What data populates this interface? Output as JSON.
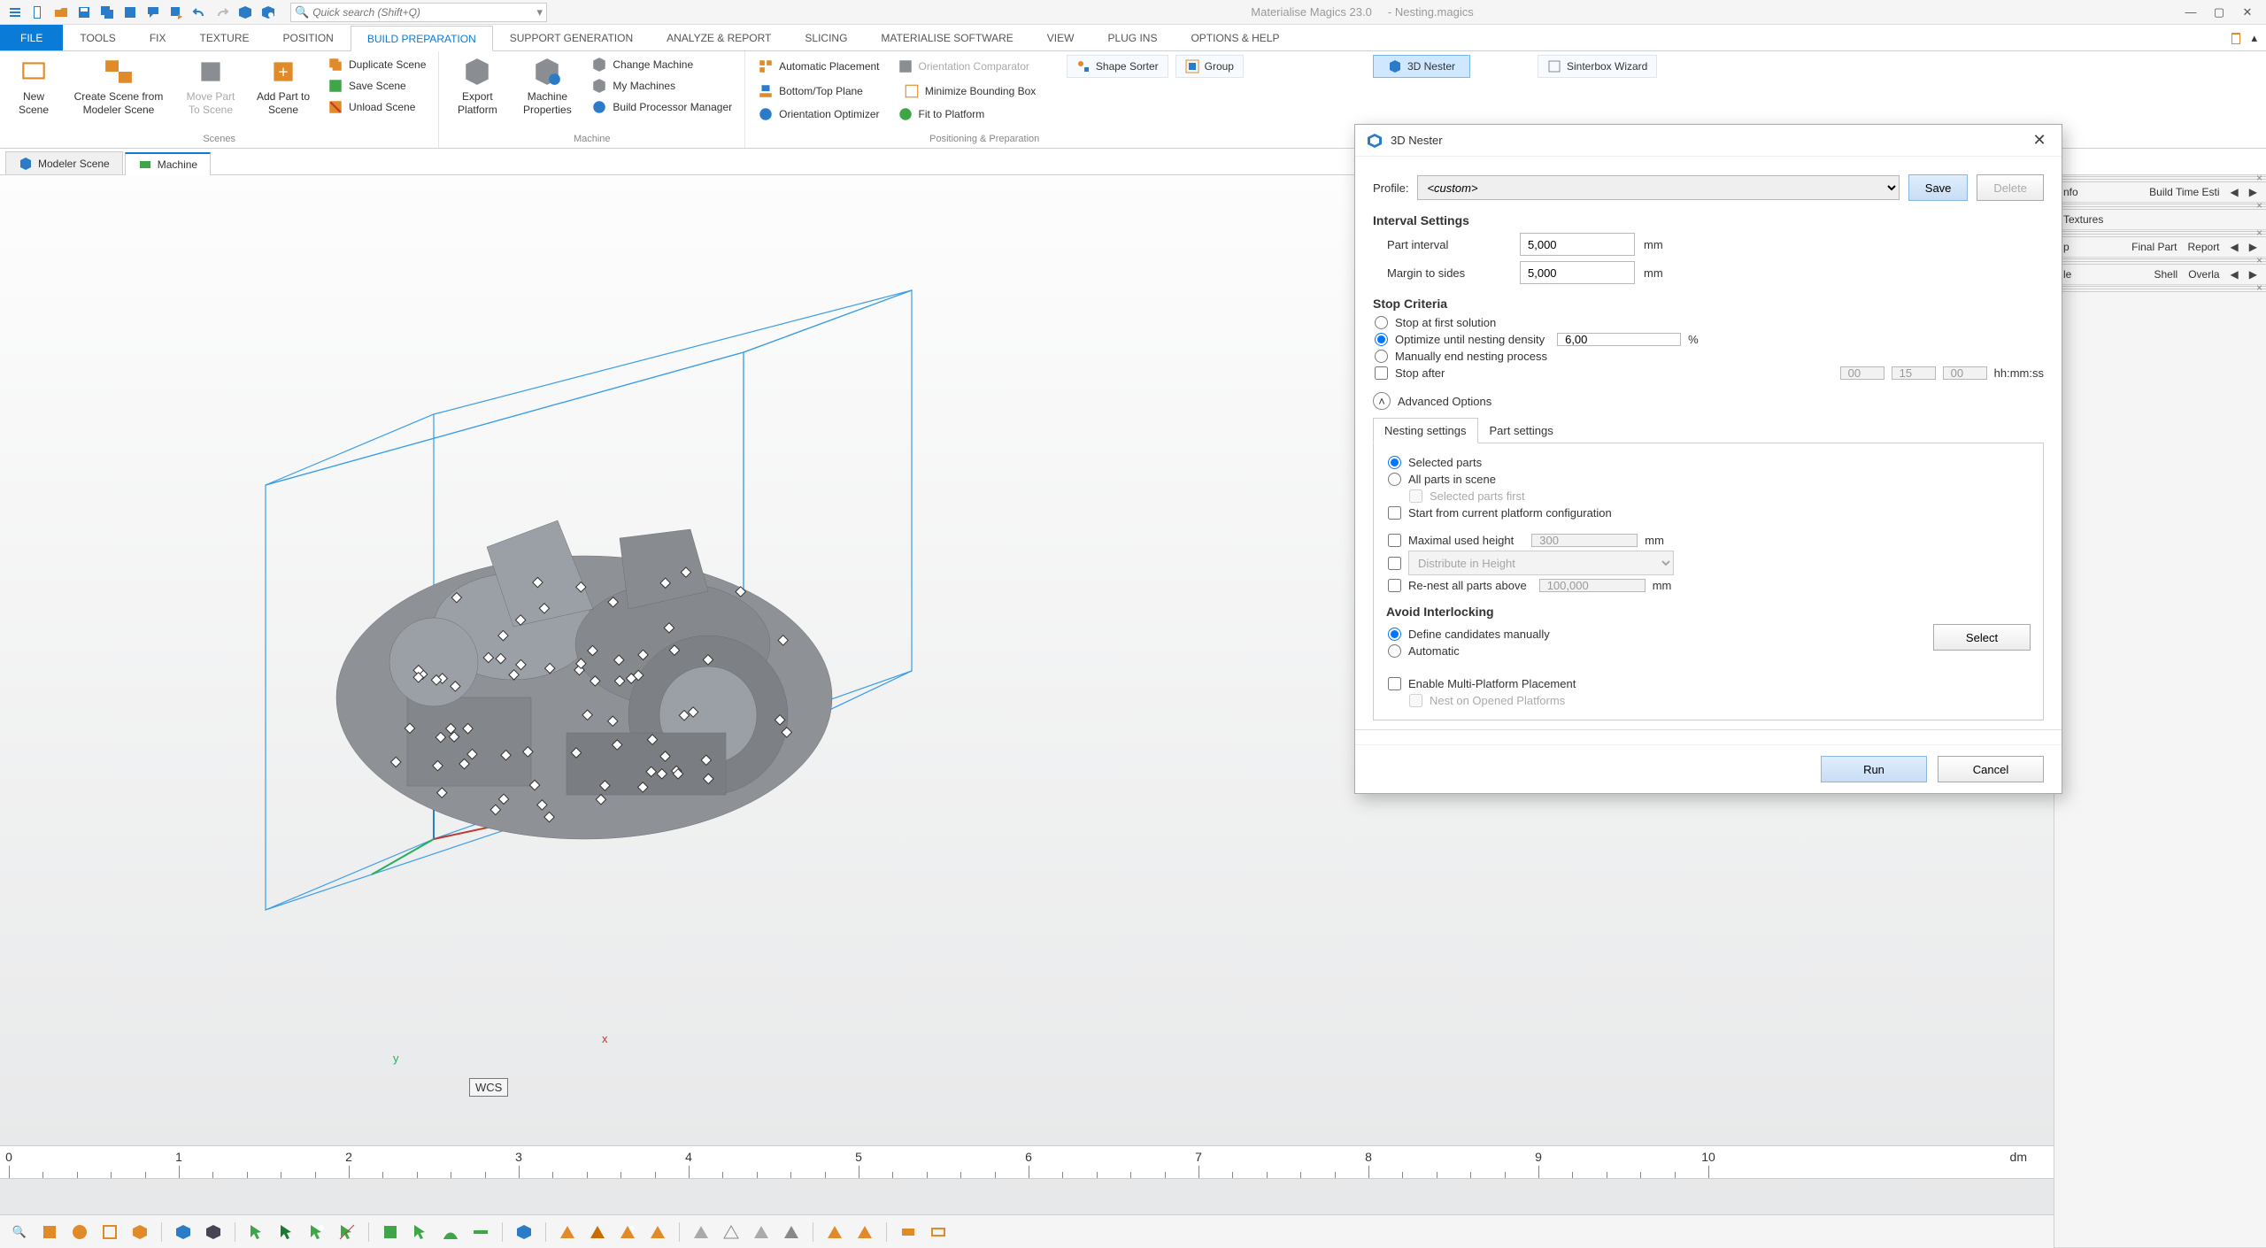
{
  "app": {
    "title_product": "Materialise Magics 23.0",
    "title_file": "- Nesting.magics",
    "search_placeholder": "Quick search (Shift+Q)"
  },
  "ribbon_tabs": {
    "file": "FILE",
    "items": [
      "TOOLS",
      "FIX",
      "TEXTURE",
      "POSITION",
      "BUILD PREPARATION",
      "SUPPORT GENERATION",
      "ANALYZE & REPORT",
      "SLICING",
      "MATERIALISE SOFTWARE",
      "VIEW",
      "PLUG INS",
      "OPTIONS & HELP"
    ],
    "active_index": 4
  },
  "ribbon": {
    "scenes": {
      "label": "Scenes",
      "new_scene": "New\nScene",
      "create_from_modeler": "Create Scene from\nModeler Scene",
      "move_to_scene": "Move Part\nTo Scene",
      "add_to_scene": "Add Part to\nScene",
      "duplicate": "Duplicate Scene",
      "save": "Save Scene",
      "unload": "Unload Scene"
    },
    "machine": {
      "label": "Machine",
      "export_platform": "Export\nPlatform",
      "machine_properties": "Machine\nProperties",
      "change_machine": "Change Machine",
      "my_machines": "My Machines",
      "bpm": "Build Processor Manager"
    },
    "positioning": {
      "label": "Positioning & Preparation",
      "auto_place": "Automatic Placement",
      "bottom_top": "Bottom/Top Plane",
      "orient_opt": "Orientation Optimizer",
      "orient_cmp": "Orientation Comparator",
      "min_bbox": "Minimize Bounding Box",
      "fit_platform": "Fit to Platform",
      "shape_sorter": "Shape Sorter",
      "group": "Group",
      "nester": "3D Nester",
      "sinterbox": "Sinterbox Wizard"
    }
  },
  "doc_tabs": {
    "modeler": "Modeler Scene",
    "machine": "Machine"
  },
  "viewport": {
    "wcs": "WCS",
    "axis_x": "x",
    "axis_y": "y"
  },
  "ruler": {
    "unit": "dm",
    "labels": [
      "0",
      "1",
      "2",
      "3",
      "4",
      "5",
      "6",
      "7",
      "8",
      "9",
      "10"
    ]
  },
  "right_panels": {
    "p1": [
      "nfo",
      "Build Time Esti"
    ],
    "p2": [
      "Textures"
    ],
    "p3": [
      "p",
      "Final Part",
      "Report"
    ],
    "p4": [
      "le",
      "Shell",
      "Overla"
    ]
  },
  "dialog": {
    "title": "3D Nester",
    "profile_label": "Profile:",
    "profile_value": "<custom>",
    "save": "Save",
    "delete": "Delete",
    "interval_h": "Interval Settings",
    "part_interval_label": "Part interval",
    "part_interval_value": "5,000",
    "margin_label": "Margin to sides",
    "margin_value": "5,000",
    "mm": "mm",
    "stop_h": "Stop Criteria",
    "stop_first": "Stop at first solution",
    "stop_density": "Optimize until nesting density",
    "stop_density_value": "6,00",
    "pct": "%",
    "stop_manual": "Manually end nesting process",
    "stop_after": "Stop after",
    "stop_hh": "00",
    "stop_mm": "15",
    "stop_ss": "00",
    "hhmmss": "hh:mm:ss",
    "advanced": "Advanced Options",
    "tab_nesting": "Nesting settings",
    "tab_part": "Part settings",
    "sel_parts": "Selected parts",
    "all_parts": "All parts in scene",
    "sel_first": "Selected parts first",
    "start_current": "Start from current platform configuration",
    "max_height": "Maximal used height",
    "max_height_value": "300",
    "distribute": "Distribute in Height",
    "renest_above": "Re-nest all parts above",
    "renest_value": "100,000",
    "avoid_h": "Avoid Interlocking",
    "define_manual": "Define candidates manually",
    "automatic": "Automatic",
    "select_btn": "Select",
    "enable_multi": "Enable Multi-Platform Placement",
    "nest_opened": "Nest on Opened Platforms",
    "run": "Run",
    "cancel": "Cancel"
  }
}
